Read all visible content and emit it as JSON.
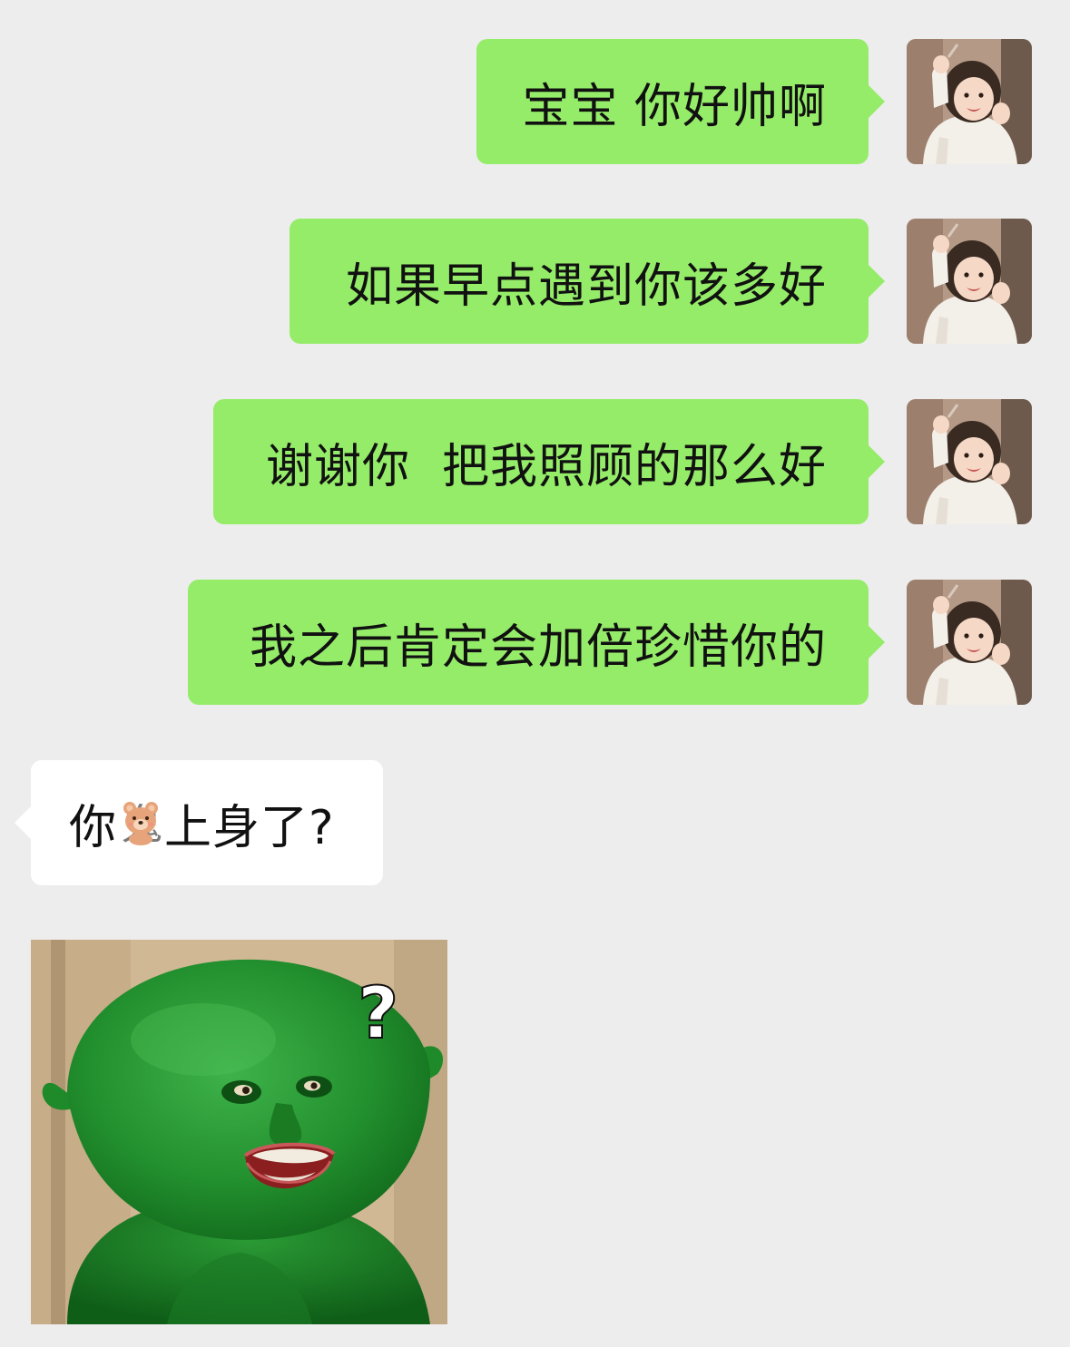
{
  "messages": [
    {
      "side": "out",
      "text": "宝宝 你好帅啊"
    },
    {
      "side": "out",
      "text": "如果早点遇到你该多好"
    },
    {
      "side": "out",
      "text": "谢谢你  把我照顾的那么好"
    },
    {
      "side": "out",
      "text": "我之后肯定会加倍珍惜你的"
    }
  ],
  "reply": {
    "before": "你",
    "hidden_char_icon": "bear-emoji-icon",
    "after": "上身了?"
  },
  "sticker": {
    "icon": "green-face-meme-sticker",
    "overlay_text": "?"
  },
  "avatar_icon": "toddler-waving-avatar",
  "colors": {
    "background": "#ededed",
    "outgoing_bubble": "#95ec69",
    "incoming_bubble": "#ffffff",
    "text": "#111111"
  }
}
